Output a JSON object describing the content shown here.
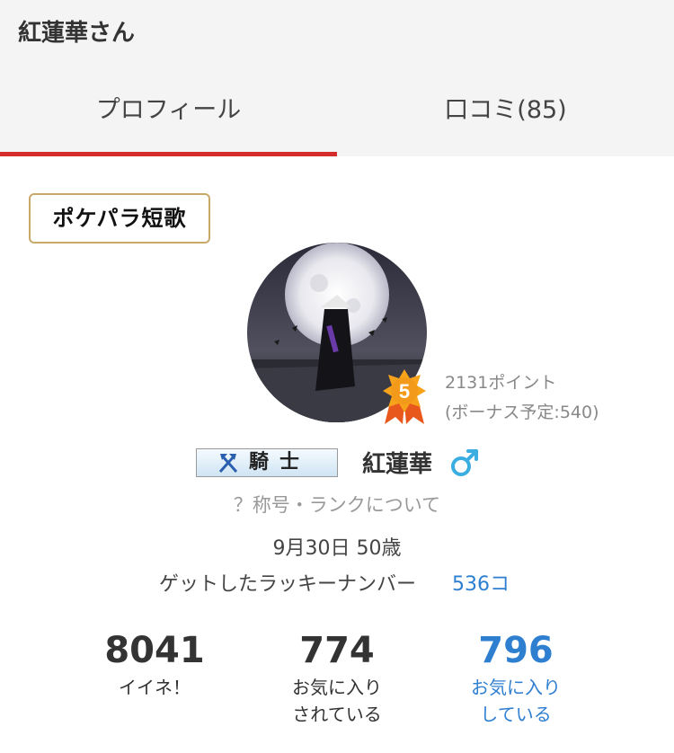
{
  "header": {
    "title": "紅蓮華さん",
    "tabs": [
      {
        "label": "プロフィール",
        "active": true
      },
      {
        "label": "口コミ(85)",
        "active": false
      }
    ]
  },
  "profile": {
    "badge": "ポケパラ短歌",
    "level": "5",
    "points": "2131ポイント",
    "bonus": "(ボーナス予定:540)",
    "rank_title": "騎士",
    "username": "紅蓮華",
    "gender_icon": "male-icon",
    "rank_link": "？称号・ランクについて",
    "birthday_age": "9月30日 50歳",
    "lucky_label": "ゲットしたラッキーナンバー",
    "lucky_count": "536コ"
  },
  "stats": [
    {
      "value": "8041",
      "label_line1": "イイネ！",
      "label_line2": ""
    },
    {
      "value": "774",
      "label_line1": "お気に入り",
      "label_line2": "されている"
    },
    {
      "value": "796",
      "label_line1": "お気に入り",
      "label_line2": "している"
    }
  ],
  "colors": {
    "accent_red": "#d42b2b",
    "link_blue": "#2f7fd1",
    "badge_border": "#c9a96a"
  }
}
